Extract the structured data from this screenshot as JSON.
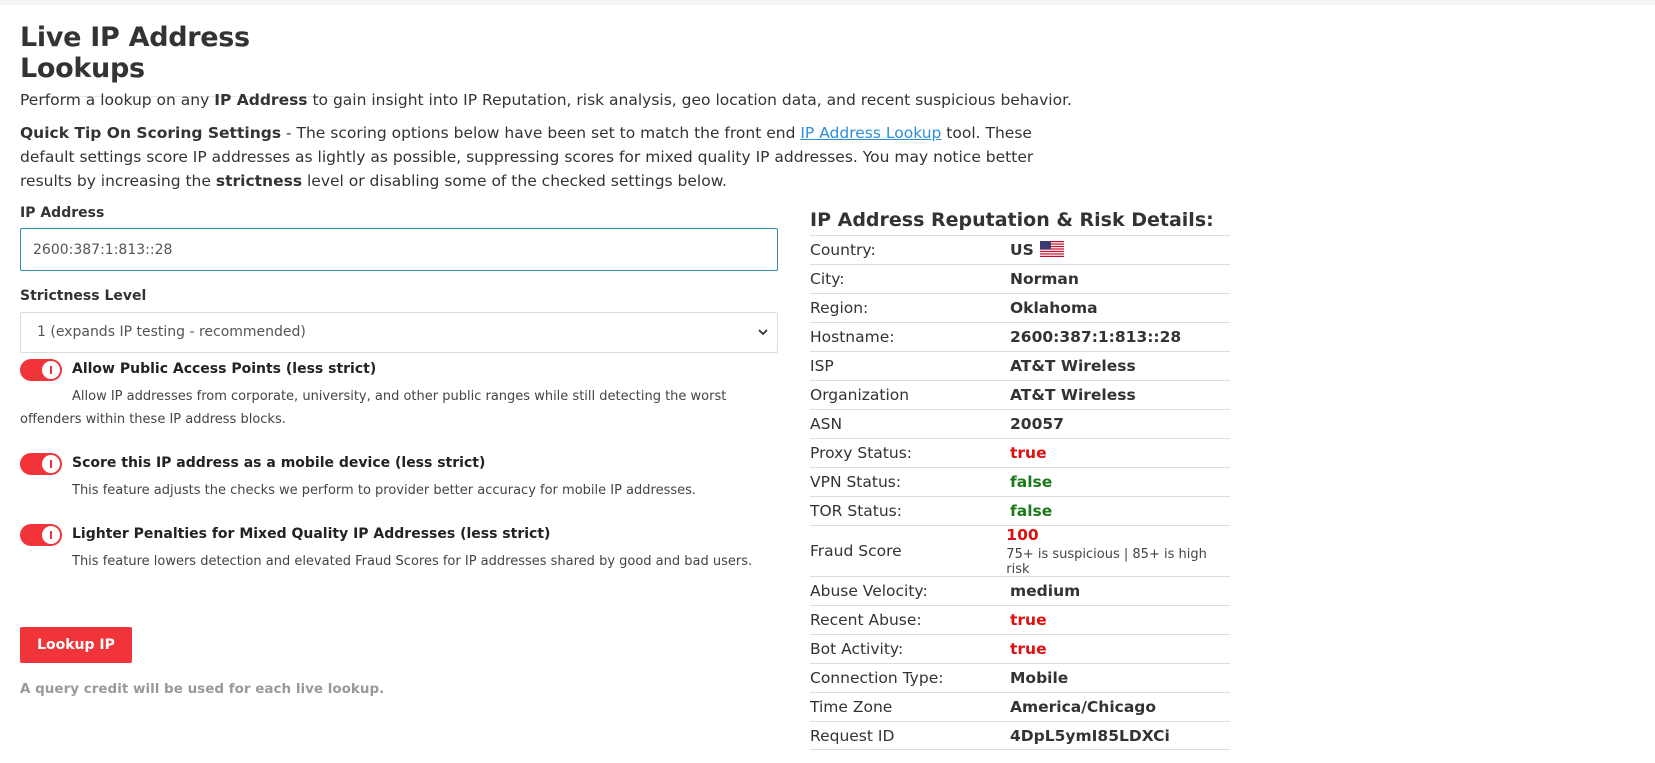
{
  "page": {
    "title": "Live IP Address Lookups",
    "intro_1": "Perform a lookup on any ",
    "intro_bold": "IP Address",
    "intro_2": " to gain insight into IP Reputation, risk analysis, geo location data, and recent suspicious behavior.",
    "tip_bold": "Quick Tip On Scoring Settings",
    "tip_1": " - The scoring options below have been set to match the front end ",
    "tip_link": "IP Address Lookup",
    "tip_2": " tool. These default settings score IP addresses as lightly as possible, suppressing scores for mixed quality IP addresses. You may notice better results by increasing the ",
    "tip_bold_2": "strictness",
    "tip_3": " level or disabling some of the checked settings below."
  },
  "form": {
    "ip_label": "IP Address",
    "ip_value": "2600:387:1:813::28",
    "strict_label": "Strictness Level",
    "strict_value": "1 (expands IP testing - recommended)",
    "options": [
      {
        "title": "Allow Public Access Points (less strict)",
        "desc": "Allow IP addresses from corporate, university, and other public ranges while still detecting the worst offenders within these IP address blocks.",
        "enabled": true
      },
      {
        "title": "Score this IP address as a mobile device (less strict)",
        "desc": "This feature adjusts the checks we perform to provider better accuracy for mobile IP addresses.",
        "enabled": true
      },
      {
        "title": "Lighter Penalties for Mixed Quality IP Addresses (less strict)",
        "desc": "This feature lowers detection and elevated Fraud Scores for IP addresses shared by good and bad users.",
        "enabled": true
      }
    ],
    "button": "Lookup IP",
    "credit_note": "A query credit will be used for each live lookup."
  },
  "details": {
    "title": "IP Address Reputation & Risk Details:",
    "rows": [
      {
        "key": "Country:",
        "value": "US"
      },
      {
        "key": "City:",
        "value": "Norman"
      },
      {
        "key": "Region:",
        "value": "Oklahoma"
      },
      {
        "key": "Hostname:",
        "value": "2600:387:1:813::28"
      },
      {
        "key": "ISP",
        "value": "AT&T Wireless"
      },
      {
        "key": "Organization",
        "value": "AT&T Wireless"
      },
      {
        "key": "ASN",
        "value": "20057"
      },
      {
        "key": "Proxy Status:",
        "value": "true"
      },
      {
        "key": "VPN Status:",
        "value": "false"
      },
      {
        "key": "TOR Status:",
        "value": "false"
      },
      {
        "key": "Fraud Score",
        "value": "100",
        "sub": "75+ is suspicious | 85+ is high risk"
      },
      {
        "key": "Abuse Velocity:",
        "value": "medium"
      },
      {
        "key": "Recent Abuse:",
        "value": "true"
      },
      {
        "key": "Bot Activity:",
        "value": "true"
      },
      {
        "key": "Connection Type:",
        "value": "Mobile"
      },
      {
        "key": "Time Zone",
        "value": "America/Chicago"
      },
      {
        "key": "Request ID",
        "value": "4DpL5ymI85LDXCi"
      }
    ]
  },
  "colors": {
    "accent": "#f0343a",
    "true": "#e01010",
    "false": "#1a7a1a",
    "link": "#2d8fd5"
  },
  "icons": {
    "toggle": "toggle-switch",
    "select": "chevron-down-icon",
    "flag": "us-flag-icon"
  }
}
